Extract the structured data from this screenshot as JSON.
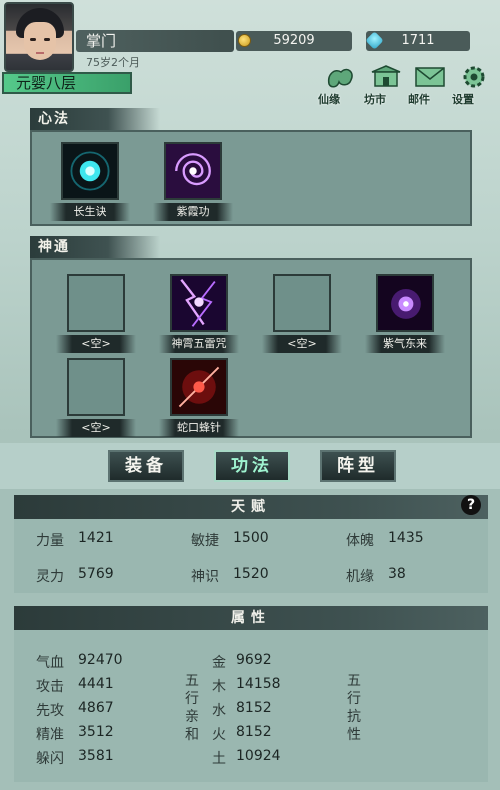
{
  "player": {
    "name": "掌门",
    "age": "75岁2个月",
    "realm": "元婴八层"
  },
  "resources": {
    "gold": "59209",
    "jade": "1711"
  },
  "top_menu": [
    {
      "label": "仙缘",
      "icon": "immortal-fate-icon"
    },
    {
      "label": "坊市",
      "icon": "market-icon"
    },
    {
      "label": "邮件",
      "icon": "mail-icon"
    },
    {
      "label": "设置",
      "icon": "gear-icon"
    }
  ],
  "xinfa": {
    "title": "心法",
    "skills": [
      {
        "name": "长生诀",
        "icon": "cyan-orb-skill-icon",
        "empty": false
      },
      {
        "name": "紫霞功",
        "icon": "purple-swirl-skill-icon",
        "empty": false
      }
    ]
  },
  "shentong": {
    "title": "神通",
    "skills": [
      {
        "name": "<空>",
        "empty": true
      },
      {
        "name": "神霄五雷咒",
        "icon": "purple-lightning-skill-icon",
        "empty": false
      },
      {
        "name": "<空>",
        "empty": true
      },
      {
        "name": "紫气东来",
        "icon": "purple-burst-skill-icon",
        "empty": false
      },
      {
        "name": "<空>",
        "empty": true
      },
      {
        "name": "蛇口蜂针",
        "icon": "red-needle-skill-icon",
        "empty": false
      }
    ]
  },
  "tabs": [
    {
      "label": "装备",
      "active": false
    },
    {
      "label": "功法",
      "active": true
    },
    {
      "label": "阵型",
      "active": false
    }
  ],
  "talent": {
    "title": "天赋",
    "help": "?",
    "items": [
      {
        "label": "力量",
        "value": "1421"
      },
      {
        "label": "敏捷",
        "value": "1500"
      },
      {
        "label": "体魄",
        "value": "1435"
      },
      {
        "label": "灵力",
        "value": "5769"
      },
      {
        "label": "神识",
        "value": "1520"
      },
      {
        "label": "机缘",
        "value": "38"
      }
    ]
  },
  "attributes": {
    "title": "属性",
    "basic": [
      {
        "label": "气血",
        "value": "92470"
      },
      {
        "label": "攻击",
        "value": "4441"
      },
      {
        "label": "先攻",
        "value": "4867"
      },
      {
        "label": "精准",
        "value": "3512"
      },
      {
        "label": "躲闪",
        "value": "3581"
      }
    ],
    "affinity_label": "五行亲和",
    "affinity": [
      {
        "label": "金",
        "value": "9692"
      },
      {
        "label": "木",
        "value": "14158"
      },
      {
        "label": "水",
        "value": "8152"
      },
      {
        "label": "火",
        "value": "8152"
      },
      {
        "label": "土",
        "value": "10924"
      }
    ],
    "resist_label": "五行抗性"
  },
  "colors": {
    "accent": "#55c98a",
    "panel": "#7b9a94",
    "dark": "#2c3b3a",
    "active_tab": "#9ff4d0"
  }
}
